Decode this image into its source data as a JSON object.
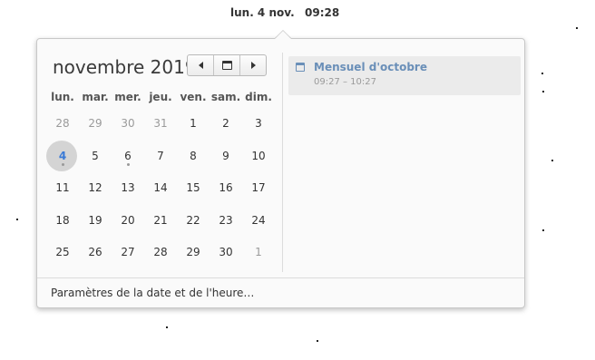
{
  "topbar": {
    "date": "lun. 4 nov.",
    "time": "09:28"
  },
  "calendar": {
    "month_title": "novembre 2019",
    "weekdays": [
      "lun.",
      "mar.",
      "mer.",
      "jeu.",
      "ven.",
      "sam.",
      "dim."
    ],
    "weeks": [
      [
        {
          "d": "28",
          "other": true
        },
        {
          "d": "29",
          "other": true
        },
        {
          "d": "30",
          "other": true
        },
        {
          "d": "31",
          "other": true
        },
        {
          "d": "1"
        },
        {
          "d": "2"
        },
        {
          "d": "3"
        }
      ],
      [
        {
          "d": "4",
          "today": true,
          "event": true
        },
        {
          "d": "5"
        },
        {
          "d": "6",
          "event": true
        },
        {
          "d": "7"
        },
        {
          "d": "8"
        },
        {
          "d": "9"
        },
        {
          "d": "10"
        }
      ],
      [
        {
          "d": "11"
        },
        {
          "d": "12"
        },
        {
          "d": "13"
        },
        {
          "d": "14"
        },
        {
          "d": "15"
        },
        {
          "d": "16"
        },
        {
          "d": "17"
        }
      ],
      [
        {
          "d": "18"
        },
        {
          "d": "19"
        },
        {
          "d": "20"
        },
        {
          "d": "21"
        },
        {
          "d": "22"
        },
        {
          "d": "23"
        },
        {
          "d": "24"
        }
      ],
      [
        {
          "d": "25"
        },
        {
          "d": "26"
        },
        {
          "d": "27"
        },
        {
          "d": "28"
        },
        {
          "d": "29"
        },
        {
          "d": "30"
        },
        {
          "d": "1",
          "other": true
        }
      ]
    ],
    "nav_icons": [
      "chevron-left-icon",
      "calendar-icon",
      "chevron-right-icon"
    ]
  },
  "events": [
    {
      "title": "Mensuel d'octobre",
      "time": "09:27 – 10:27",
      "icon": "calendar-icon"
    }
  ],
  "footer": {
    "settings_label": "Paramètres de la date et de l'heure…"
  },
  "colors": {
    "accent": "#3a7ad6",
    "event": "#6a8fb8",
    "today_bg": "#d4d4d4"
  }
}
